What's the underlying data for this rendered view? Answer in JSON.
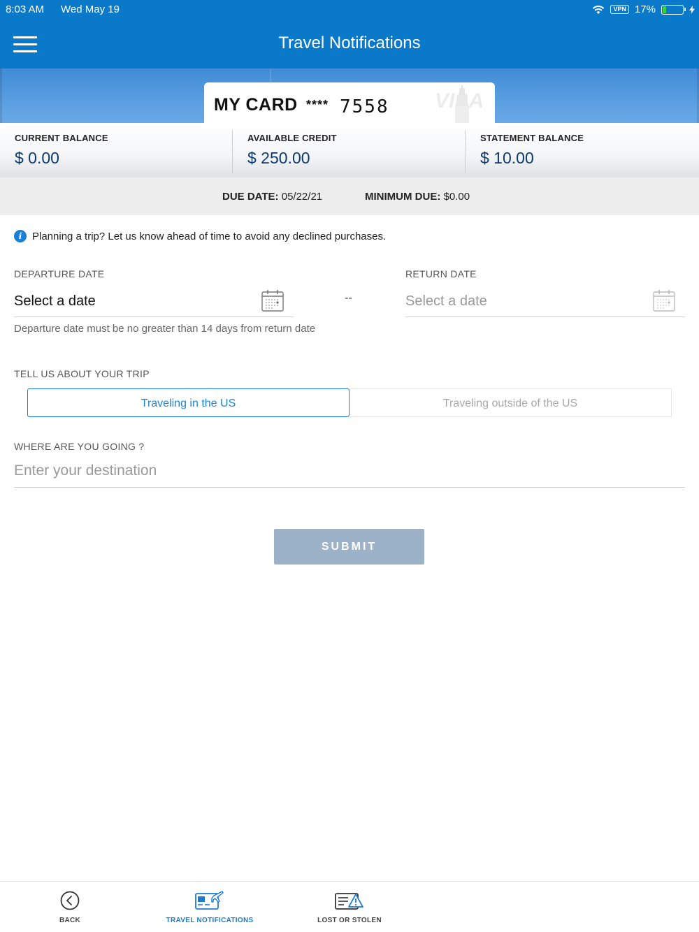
{
  "status_bar": {
    "time": "8:03 AM",
    "date": "Wed May 19",
    "vpn": "VPN",
    "battery": "17%",
    "battery_level": 0.17
  },
  "header": {
    "title": "Travel Notifications",
    "menu_icon": "hamburger-menu-icon"
  },
  "card": {
    "name": "MY CARD",
    "mask": "****",
    "last4": "7558",
    "network": "VISA"
  },
  "balances": [
    {
      "label": "CURRENT BALANCE",
      "value": "$ 0.00"
    },
    {
      "label": "AVAILABLE CREDIT",
      "value": "$ 250.00"
    },
    {
      "label": "STATEMENT BALANCE",
      "value": "$ 10.00"
    }
  ],
  "due": {
    "due_date_label": "DUE DATE:",
    "due_date_value": "05/22/21",
    "min_due_label": "MINIMUM DUE:",
    "min_due_value": "$0.00"
  },
  "form": {
    "info": "Planning a trip? Let us know ahead of time to avoid any declined purchases.",
    "departure_label": "DEPARTURE DATE",
    "departure_value": "Select a date",
    "separator": "--",
    "return_label": "RETURN DATE",
    "return_value": "Select a date",
    "hint": "Departure date must be no greater than 14 days from return date",
    "trip_label": "TELL US ABOUT YOUR TRIP",
    "trip_options": [
      "Traveling in the US",
      "Traveling outside of the US"
    ],
    "trip_selected": "Traveling in the US",
    "destination_label": "WHERE ARE YOU GOING ?",
    "destination_placeholder": "Enter your destination",
    "destination_value": "",
    "submit": "SUBMIT"
  },
  "tabs": [
    {
      "label": "BACK",
      "icon": "back-circle-icon"
    },
    {
      "label": "TRAVEL NOTIFICATIONS",
      "icon": "travel-card-plane-icon",
      "active": true
    },
    {
      "label": "LOST OR STOLEN",
      "icon": "card-warning-icon"
    }
  ],
  "colors": {
    "brand": "#0a79c9",
    "accent": "#1c7bd0",
    "balance_value": "#0b3b6e",
    "submit_disabled": "#9cb2c9"
  }
}
